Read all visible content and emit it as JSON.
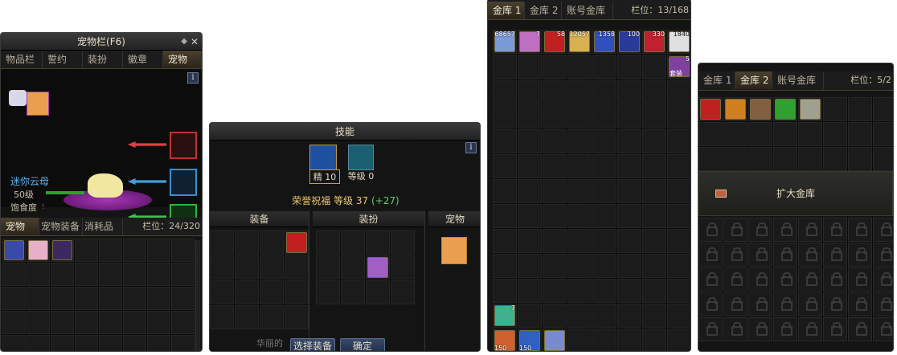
{
  "pet_window": {
    "title": "宠物栏(F6)",
    "tabs": [
      "物品栏",
      "誓约",
      "装扮",
      "徽章",
      "宠物"
    ],
    "pet_name": "迷你云母",
    "pet_level": "50级",
    "satiety_label": "饱食度",
    "satiety_marker": "!",
    "sub_tabs": [
      "宠物",
      "宠物装备",
      "消耗品"
    ],
    "slot_label": "栏位：24/320",
    "info_icon": "i",
    "close_icon": "✕",
    "pin_icon": "📌",
    "items": [
      {
        "color": "#3a4aa8"
      },
      {
        "color": "#e8b0c8"
      },
      {
        "color": "#3a2a60"
      }
    ]
  },
  "skill_window": {
    "title": "技能",
    "info_icon": "i",
    "skill_label": "精 10",
    "level_label": "等级 0",
    "bless_label": "荣誉祝福  等级 37",
    "bless_bonus": "(+27)",
    "section_equip": "装备",
    "section_avatar": "装扮",
    "section_pet": "宠物",
    "select_button": "选择装备",
    "confirm_button": "确定",
    "bottom_text": "华丽的"
  },
  "gold_vault": {
    "tabs": [
      "金库 1",
      "金库 2",
      "账号金库"
    ],
    "slot_label": "栏位：13/168",
    "items": [
      {
        "num": "68657",
        "color": "#7a9ad8"
      },
      {
        "num": "7",
        "color": "#c070c0"
      },
      {
        "num": "58",
        "color": "#c02020"
      },
      {
        "num": "12057",
        "color": "#d8b050"
      },
      {
        "num": "1358",
        "color": "#3050c0"
      },
      {
        "num": "100",
        "color": "#2a3a9a"
      },
      {
        "num": "330",
        "color": "#c02030"
      },
      {
        "num": "1840",
        "color": "#e0e0e0"
      }
    ],
    "set_item_label": "套装",
    "set_item_num": "5",
    "bottom_item_num": "7",
    "bottom_items": [
      {
        "num": "150",
        "color": "#d06030"
      },
      {
        "num": "150",
        "color": "#3060c0"
      },
      {
        "num": "",
        "color": "#7a8ad0"
      }
    ]
  },
  "gold_vault2": {
    "tabs": [
      "金库 1",
      "金库 2",
      "账号金库"
    ],
    "slot_label": "栏位：5/2",
    "expand_label": "扩大金库",
    "items": [
      {
        "color": "#c02020"
      },
      {
        "color": "#d08020"
      },
      {
        "color": "#806040"
      },
      {
        "color": "#30a030"
      },
      {
        "color": "#a0a090"
      }
    ]
  }
}
